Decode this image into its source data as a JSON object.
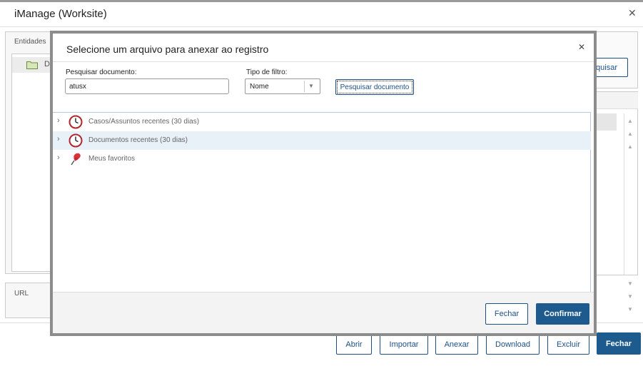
{
  "window": {
    "title": "iManage (Worksite)"
  },
  "background": {
    "entities_label": "Entidades",
    "folder_partial_label": "D",
    "search_button_partial": "quisar",
    "url_label": "URL"
  },
  "footer_buttons": {
    "abrir": "Abrir",
    "importar": "Importar",
    "anexar": "Anexar",
    "download": "Download",
    "excluir": "Excluir",
    "fechar": "Fechar"
  },
  "dialog": {
    "title": "Selecione um arquivo para anexar ao registro",
    "search_label": "Pesquisar documento:",
    "search_value": "atusx",
    "filter_label": "Tipo de filtro:",
    "filter_value": "Nome",
    "search_button": "Pesquisar documento",
    "tree": [
      {
        "label": "Casos/Assuntos recentes (30 dias)",
        "icon": "clock-icon",
        "selected": false
      },
      {
        "label": "Documentos recentes (30 dias)",
        "icon": "clock-icon",
        "selected": true
      },
      {
        "label": "Meus favoritos",
        "icon": "pushpin-icon",
        "selected": false
      }
    ],
    "close_button": "Fechar",
    "confirm_button": "Confirmar"
  },
  "colors": {
    "accent": "#1d5a8e",
    "overlay": "#8c8c8c",
    "selected_row": "#e8f0f8"
  }
}
